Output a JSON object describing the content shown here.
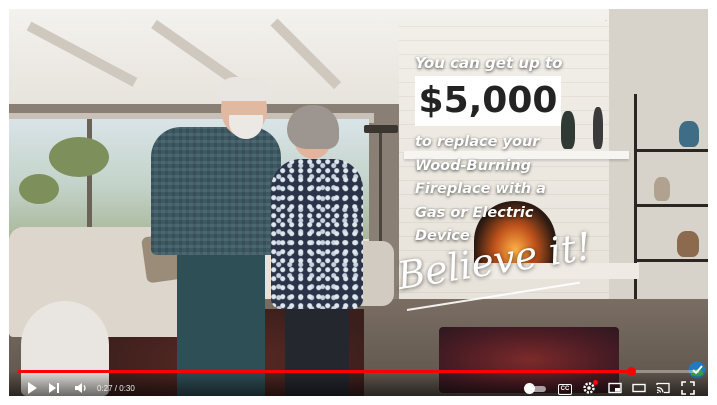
{
  "video": {
    "overlay": {
      "line1": "You can get up to",
      "amount": "$5,000",
      "body_lines": [
        "to replace your",
        "Wood-Burning",
        "Fireplace with a",
        "Gas or Electric",
        "Device"
      ],
      "tagline": "Believe it!"
    }
  },
  "player": {
    "progress": {
      "current_time": "0:27",
      "duration": "0:30",
      "time_display": "0:27 / 0:30",
      "played_fraction": 0.9,
      "color": "#ff0000"
    },
    "controls_left": [
      "play-icon",
      "next-icon",
      "volume-icon"
    ],
    "controls_right": [
      "autoplay-toggle",
      "subtitles-icon",
      "settings-icon",
      "miniplayer-icon",
      "theater-icon",
      "cast-icon",
      "fullscreen-icon"
    ],
    "captions_label": "CC",
    "autoplay_on": true
  }
}
